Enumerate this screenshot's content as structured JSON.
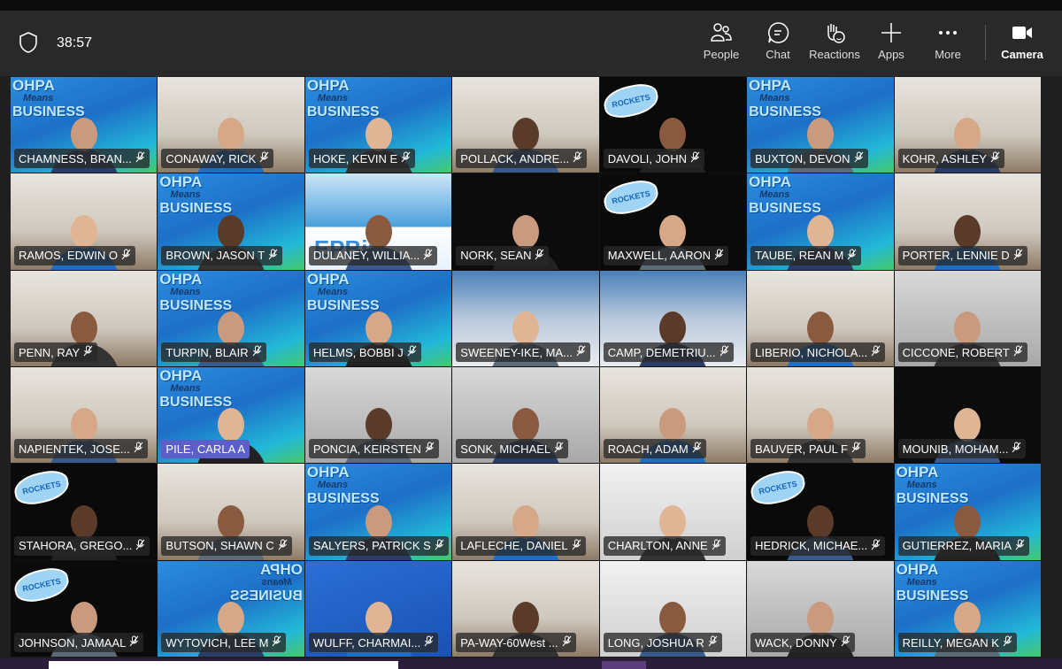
{
  "meeting": {
    "timer": "38:57"
  },
  "toolbar": {
    "people": "People",
    "chat": "Chat",
    "reactions": "Reactions",
    "apps": "Apps",
    "more": "More",
    "camera": "Camera"
  },
  "logo_text": {
    "ohpa_line1": "OHPA",
    "ohpa_line2": "Means",
    "ohpa_line3": "BUSINESS",
    "city": "EPBiz",
    "team": "ROCKETS"
  },
  "participants": [
    {
      "name": "CHAMNESS, BRAN...",
      "bg": "ohpa",
      "muted": true
    },
    {
      "name": "CONAWAY, RICK",
      "bg": "office",
      "muted": true
    },
    {
      "name": "HOKE, KEVIN E",
      "bg": "ohpa",
      "muted": true
    },
    {
      "name": "POLLACK, ANDRE...",
      "bg": "office",
      "muted": true
    },
    {
      "name": "DAVOLI, JOHN",
      "bg": "logo",
      "muted": true
    },
    {
      "name": "BUXTON, DEVON",
      "bg": "ohpa",
      "muted": true
    },
    {
      "name": "KOHR, ASHLEY",
      "bg": "office",
      "muted": true
    },
    {
      "name": "RAMOS, EDWIN O",
      "bg": "office",
      "muted": true
    },
    {
      "name": "BROWN, JASON T",
      "bg": "ohpa",
      "muted": true
    },
    {
      "name": "DULANEY, WILLIA...",
      "bg": "city",
      "muted": true
    },
    {
      "name": "NORK, SEAN",
      "bg": "dark",
      "muted": true
    },
    {
      "name": "MAXWELL, AARON",
      "bg": "logo",
      "muted": true
    },
    {
      "name": "TAUBE, REAN M",
      "bg": "ohpa",
      "muted": true
    },
    {
      "name": "PORTER, LENNIE D",
      "bg": "office",
      "muted": true
    },
    {
      "name": "PENN, RAY",
      "bg": "office",
      "muted": true
    },
    {
      "name": "TURPIN, BLAIR",
      "bg": "ohpa",
      "muted": true
    },
    {
      "name": "HELMS, BOBBI J",
      "bg": "ohpa",
      "muted": true
    },
    {
      "name": "SWEENEY-IKE, MA...",
      "bg": "sky",
      "muted": true
    },
    {
      "name": "CAMP, DEMETRIU...",
      "bg": "sky",
      "muted": true
    },
    {
      "name": "LIBERIO, NICHOLA...",
      "bg": "office",
      "muted": true
    },
    {
      "name": "CICCONE, ROBERT",
      "bg": "grey",
      "muted": true
    },
    {
      "name": "NAPIENTEK, JOSE...",
      "bg": "office",
      "muted": true
    },
    {
      "name": "PILE, CARLA A",
      "bg": "ohpa",
      "muted": false,
      "speaking": true
    },
    {
      "name": "PONCIA, KEIRSTEN",
      "bg": "grey",
      "muted": true
    },
    {
      "name": "SONK, MICHAEL",
      "bg": "grey",
      "muted": true
    },
    {
      "name": "ROACH, ADAM",
      "bg": "office",
      "muted": true
    },
    {
      "name": "BAUVER, PAUL F",
      "bg": "office",
      "muted": true
    },
    {
      "name": "MOUNIB, MOHAM...",
      "bg": "dark",
      "muted": true
    },
    {
      "name": "STAHORA, GREGO...",
      "bg": "logo",
      "muted": true
    },
    {
      "name": "BUTSON, SHAWN C",
      "bg": "office",
      "muted": true
    },
    {
      "name": "SALYERS, PATRICK S",
      "bg": "ohpa",
      "muted": true
    },
    {
      "name": "LAFLECHE, DANIEL",
      "bg": "office",
      "muted": true
    },
    {
      "name": "CHARLTON, ANNE",
      "bg": "light",
      "muted": true
    },
    {
      "name": "HEDRICK, MICHAE...",
      "bg": "logo",
      "muted": true
    },
    {
      "name": "GUTIERREZ, MARIA",
      "bg": "ohpa",
      "muted": true
    },
    {
      "name": "JOHNSON, JAMAAL",
      "bg": "logo",
      "muted": true
    },
    {
      "name": "WYTOVICH, LEE M",
      "bg": "ohpa-mirrored",
      "muted": true
    },
    {
      "name": "WULFF, CHARMAI...",
      "bg": "blue",
      "muted": true
    },
    {
      "name": "PA-WAY-60West ...",
      "bg": "office",
      "muted": true
    },
    {
      "name": "LONG, JOSHUA R",
      "bg": "light",
      "muted": true
    },
    {
      "name": "WACK, DONNY",
      "bg": "grey",
      "muted": true
    },
    {
      "name": "REILLY, MEGAN K",
      "bg": "ohpa",
      "muted": true
    }
  ],
  "colors": {
    "toolbar": "#292929",
    "speaking": "#5b5fc7",
    "label_bg": "#282828"
  }
}
